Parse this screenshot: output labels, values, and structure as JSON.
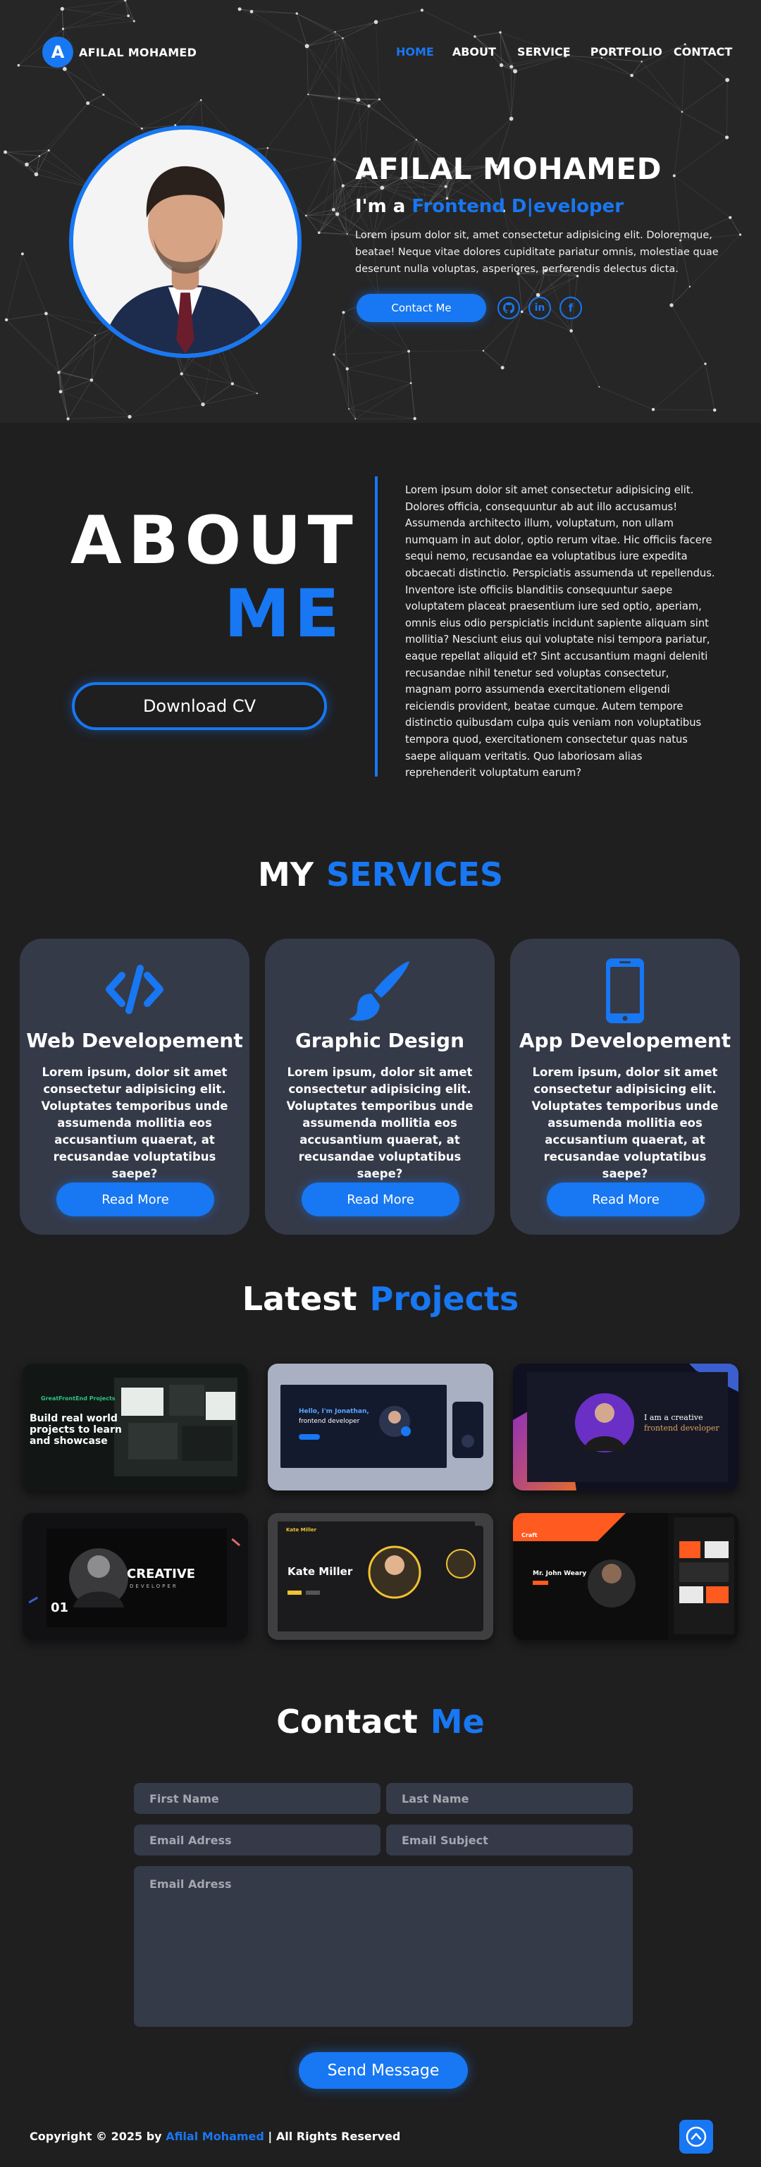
{
  "nav": {
    "logo_letter": "A",
    "brand": "AFILAL MOHAMED",
    "links": [
      "HOME",
      "ABOUT",
      "SERVICE",
      "PORTFOLIO",
      "CONTACT"
    ],
    "active_link": "HOME"
  },
  "hero": {
    "name": "AFILAL MOHAMED",
    "role_prefix": "I'm a",
    "role": "Frontend D|eveloper",
    "description": "Lorem ipsum dolor sit, amet consectetur adipisicing elit. Doloremque, beatae! Neque vitae dolores cupiditate pariatur omnis, molestiae quae deserunt nulla voluptas, asperiores, perferendis delectus dicta.",
    "contact_button": "Contact Me",
    "socials": [
      "github-icon",
      "linkedin-icon",
      "facebook-icon"
    ]
  },
  "about": {
    "title_word1": "ABOUT",
    "title_word2": "ME",
    "cv_button": "Download CV",
    "text": "Lorem ipsum dolor sit amet consectetur adipisicing elit. Dolores officia, consequuntur ab aut illo accusamus! Assumenda architecto illum, voluptatum, non ullam numquam in aut dolor, optio rerum vitae. Hic officiis facere sequi nemo, recusandae ea voluptatibus iure expedita obcaecati distinctio. Perspiciatis assumenda ut repellendus. Inventore iste officiis blanditiis consequuntur saepe voluptatem placeat praesentium iure sed optio, aperiam, omnis eius odio perspiciatis incidunt sapiente aliquam sint mollitia? Nesciunt eius qui voluptate nisi tempora pariatur, eaque repellat aliquid et? Sint accusantium magni deleniti recusandae nihil tenetur sed voluptas consectetur, magnam porro assumenda exercitationem eligendi reiciendis provident, beatae cumque. Autem tempore distinctio quibusdam culpa quis veniam non voluptatibus tempora quod, exercitationem consectetur quas natus saepe aliquam veritatis. Quo laboriosam alias reprehenderit voluptatum earum?"
  },
  "services": {
    "title_word1": "MY",
    "title_word2": "SERVICES",
    "items": [
      {
        "icon": "code-icon",
        "title": "Web Developement",
        "desc": "Lorem ipsum, dolor sit amet consectetur adipisicing elit. Voluptates temporibus unde assumenda mollitia eos accusantium quaerat, at recusandae voluptatibus saepe?",
        "button": "Read More"
      },
      {
        "icon": "paintbrush-icon",
        "title": "Graphic Design",
        "desc": "Lorem ipsum, dolor sit amet consectetur adipisicing elit. Voluptates temporibus unde assumenda mollitia eos accusantium quaerat, at recusandae voluptatibus saepe?",
        "button": "Read More"
      },
      {
        "icon": "mobile-icon",
        "title": "App Developement",
        "desc": "Lorem ipsum, dolor sit amet consectetur adipisicing elit. Voluptates temporibus unde assumenda mollitia eos accusantium quaerat, at recusandae voluptatibus saepe?",
        "button": "Read More"
      }
    ]
  },
  "projects": {
    "title_word1": "Latest",
    "title_word2": "Projects",
    "items": [
      {
        "name": "greatfrontend",
        "brand": "GreatFrontEnd Projects",
        "headline": "Build real world projects to learn and showcase"
      },
      {
        "name": "hello-portfolio",
        "headline": "Hello, I'm Jonathan,",
        "sub": "frontend developer"
      },
      {
        "name": "creative-portfolio",
        "headline": "I am a creative",
        "sub": "frontend developer"
      },
      {
        "name": "creative-developer",
        "headline": "CREATIVE",
        "sub": "DEVELOPER",
        "number": "01"
      },
      {
        "name": "kate-miller",
        "brand": "Kate Miller",
        "headline": "Kate Miller"
      },
      {
        "name": "john-weary",
        "brand": "Craft",
        "headline": "Mr. John Weary"
      }
    ]
  },
  "contact": {
    "title_word1": "Contact",
    "title_word2": "Me",
    "first_name_placeholder": "First Name",
    "last_name_placeholder": "Last Name",
    "email_placeholder": "Email Adress",
    "subject_placeholder": "Email Subject",
    "message_placeholder": "Email Adress",
    "send_button": "Send Message"
  },
  "footer": {
    "copyright_prefix": "Copyright  © 2025 by",
    "author": "Afilal Mohamed",
    "rights": "| All Rights Reserved",
    "to_top_icon": "arrow-up-circle-icon"
  },
  "colors": {
    "accent": "#1877f2",
    "background": "#1f1f20",
    "card": "#353a49"
  }
}
